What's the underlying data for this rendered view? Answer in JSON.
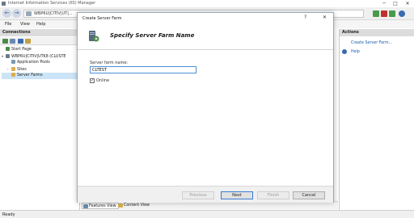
{
  "window": {
    "title": "Internet Information Services (IIS) Manager",
    "icon_name": "iis-app-icon",
    "controls": [
      "─",
      "□",
      "✕"
    ]
  },
  "address_bar": {
    "path": "WBP6U|CITIV|UT|...",
    "back_icon": "back-arrow-icon",
    "forward_icon": "forward-arrow-icon"
  },
  "menu": {
    "items": [
      "File",
      "View",
      "Help"
    ]
  },
  "connections": {
    "header": "Connections",
    "tree": [
      {
        "label": "Start Page",
        "indent": 0,
        "expander": "",
        "icon": "start-page-icon"
      },
      {
        "label": "WBP6U|CITIV|UTK8 (CLUSTE",
        "indent": 0,
        "expander": "▾",
        "icon": "server-icon"
      },
      {
        "label": "Application Pools",
        "indent": 1,
        "expander": "",
        "icon": "app-pools-icon"
      },
      {
        "label": "Sites",
        "indent": 1,
        "expander": "›",
        "icon": "sites-folder-icon"
      },
      {
        "label": "Server Farms",
        "indent": 1,
        "expander": "",
        "icon": "server-farms-icon"
      }
    ]
  },
  "bottom_tabs": [
    "Features View",
    "Content View"
  ],
  "actions": {
    "header": "Actions",
    "links": [
      "Create Server Farm...",
      "Help"
    ]
  },
  "status": {
    "text": "Ready"
  },
  "dialog": {
    "title": "Create Server Farm",
    "help_button": "?",
    "close_button": "✕",
    "heading": "Specify Server Farm Name",
    "field_label": "Server farm name:",
    "field_value": "CLTEST",
    "online_checkbox_label": "Online",
    "online_checked": true,
    "buttons": {
      "previous": "Previous",
      "next": "Next",
      "finish": "Finish",
      "cancel": "Cancel"
    }
  },
  "colors": {
    "accent": "#1a5fb4",
    "focus_border": "#4a90d9"
  }
}
